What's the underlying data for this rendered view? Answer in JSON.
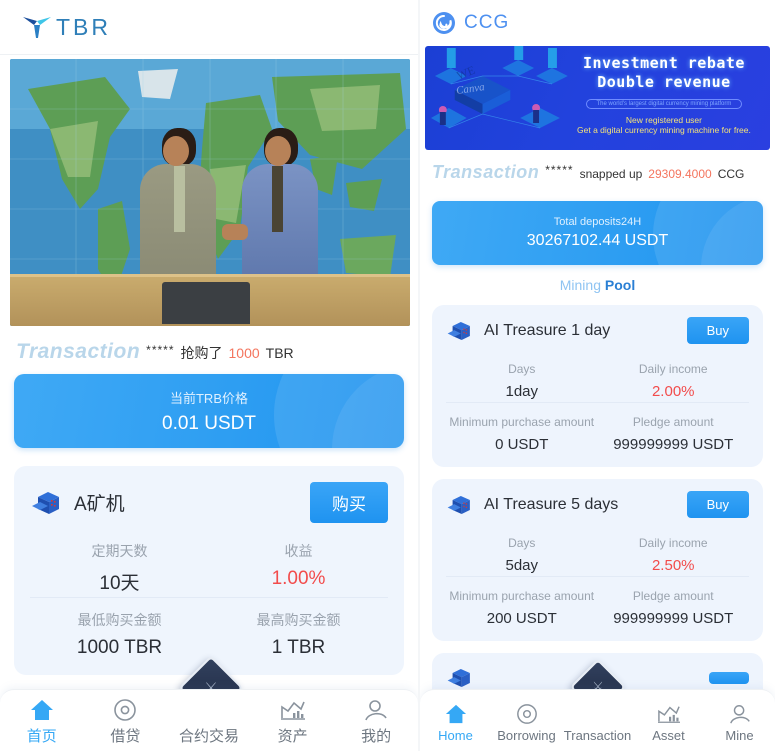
{
  "left": {
    "brand": {
      "name": "TBR",
      "mark_icon": "tbr-logo-icon"
    },
    "hero": {
      "alt": "two businessmen shaking hands in front of a world map"
    },
    "ticker": {
      "label": "Transaction",
      "stars": "*****",
      "action": "抢购了",
      "amount": "1000",
      "unit": "TBR"
    },
    "price_banner": {
      "title": "当前TRB价格",
      "value": "0.01 USDT"
    },
    "product": {
      "icon": "mining-machine-icon",
      "title": "A矿机",
      "buy_label": "购买",
      "rows": [
        {
          "cells": [
            {
              "label": "定期天数",
              "value": "10天",
              "highlight": false
            },
            {
              "label": "收益",
              "value": "1.00%",
              "highlight": true
            }
          ]
        },
        {
          "cells": [
            {
              "label": "最低购买金额",
              "value": "1000 TBR",
              "highlight": false
            },
            {
              "label": "最高购买金额",
              "value": "1 TBR",
              "highlight": false
            }
          ]
        }
      ]
    },
    "tabs": [
      {
        "label": "首页",
        "icon": "home-icon",
        "active": true
      },
      {
        "label": "借贷",
        "icon": "target-circle-icon",
        "active": false
      },
      {
        "label": "合约交易",
        "icon": "diamond-badge-icon",
        "active": false
      },
      {
        "label": "资产",
        "icon": "chart-icon",
        "active": false
      },
      {
        "label": "我的",
        "icon": "person-icon",
        "active": false
      }
    ]
  },
  "right": {
    "brand": {
      "name": "CCG",
      "mark_icon": "ccg-spiral-icon"
    },
    "banner": {
      "headline_line1": "Investment rebate",
      "headline_line2": "Double revenue",
      "pill": "The world's largest digital currency mining platform",
      "sub1": "New registered user",
      "sub2": "Get a digital currency mining machine for free."
    },
    "ticker": {
      "label": "Transaction",
      "stars": "*****",
      "action": "snapped up",
      "amount": "29309.4000",
      "unit": "CCG"
    },
    "deposit_banner": {
      "title": "Total deposits24H",
      "value": "30267102.44 USDT"
    },
    "pool_title": {
      "part1": "Mining ",
      "part2": "Pool"
    },
    "products": [
      {
        "icon": "mining-machine-icon",
        "title": "AI Treasure 1 day",
        "buy_label": "Buy",
        "rows": [
          {
            "cells": [
              {
                "label": "Days",
                "value": "1day",
                "highlight": false
              },
              {
                "label": "Daily income",
                "value": "2.00%",
                "highlight": true
              }
            ]
          },
          {
            "cells": [
              {
                "label": "Minimum purchase amount",
                "value": "0 USDT",
                "highlight": false
              },
              {
                "label": "Pledge amount",
                "value": "999999999 USDT",
                "highlight": false
              }
            ]
          }
        ]
      },
      {
        "icon": "mining-machine-icon",
        "title": "AI Treasure 5 days",
        "buy_label": "Buy",
        "rows": [
          {
            "cells": [
              {
                "label": "Days",
                "value": "5day",
                "highlight": false
              },
              {
                "label": "Daily income",
                "value": "2.50%",
                "highlight": true
              }
            ]
          },
          {
            "cells": [
              {
                "label": "Minimum purchase amount",
                "value": "200 USDT",
                "highlight": false
              },
              {
                "label": "Pledge amount",
                "value": "999999999 USDT",
                "highlight": false
              }
            ]
          }
        ]
      }
    ],
    "tabs": [
      {
        "label": "Home",
        "icon": "home-icon",
        "active": true
      },
      {
        "label": "Borrowing",
        "icon": "target-circle-icon",
        "active": false
      },
      {
        "label": "Transaction",
        "icon": "diamond-badge-icon",
        "active": false
      },
      {
        "label": "Asset",
        "icon": "chart-icon",
        "active": false
      },
      {
        "label": "Mine",
        "icon": "person-icon",
        "active": false
      }
    ]
  },
  "colors": {
    "accent_blue": "#2e9ef2",
    "brand_blue": "#4d90f0",
    "tbr_blue": "#2f7fb8",
    "red": "#f24c4c",
    "card_bg": "#eff5fd",
    "banner_indigo": "#2242dd"
  }
}
